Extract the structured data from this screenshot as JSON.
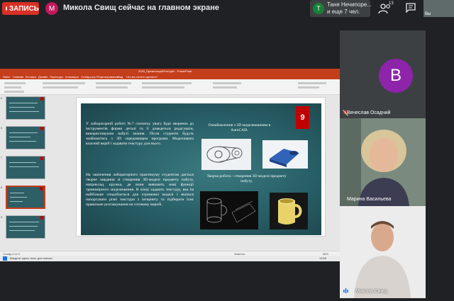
{
  "meet": {
    "record_label": "ЗАПИСЬ",
    "presenter_initial": "М",
    "presenter_text": "Микола Свищ сейчас на главном экране",
    "notification": {
      "initial": "Т",
      "line1": "Таня Нечипоре...",
      "line2": "и еще 7 чел."
    },
    "participants_count": "13",
    "self_label": "Вы",
    "colors": {
      "record": "#d93025",
      "background": "#202124",
      "tile": "#3c4043"
    }
  },
  "participants": [
    {
      "name": "Вячеслав Осадчий",
      "initial": "В",
      "muted": true,
      "avatar_color": "#8e24aa"
    },
    {
      "name": "Марина Васильева",
      "muted": false
    },
    {
      "name": "Микола Свищ",
      "muted": false,
      "speaking": true
    }
  ],
  "powerpoint": {
    "window_title": "2020_ПрезентаціяFinal.pptx - PowerPoint",
    "menu": [
      "Файл",
      "Главная",
      "Вставка",
      "Дизайн",
      "Переходы",
      "Анимация",
      "Слайд-шоу",
      "Рецензирование",
      "Вид",
      "Что вы хотите сделать?"
    ],
    "status": {
      "slide": "Слайд 9 из 9",
      "notes": "Заметки",
      "zoom": "58%"
    },
    "taskbar": {
      "search": "Введите здесь текст для поиска",
      "time": "13:55"
    },
    "accent_color": "#c43e1c"
  },
  "slide": {
    "number": "9",
    "left_paragraph_1": "У лабораторній роботі №7 спочатку увагу буде звернено до інструментів форми деталі та її доведеться редагувати, використовуючи набуті знання. Після студенти будуть знайомитись з 3D середовищем програми. Моделювати власний виріб і задавати текстуру для нього.",
    "left_paragraph_2": "На закінчення лабораторного практикуму студентам дається творче завдання зі створення 3D-моделі предмету побуту, наприклад, кружка, де вони вивчають нові функції тривимірного моделювання. В кінці задають текстуру, яка їм найбільше сподобається для отриманої моделі і вчаться імпортувати різні текстури з інтернету та підбирати їхнє правильне розташування на готовому виробі.",
    "right_heading_1": "Ознайомлення з 3D моделюванням в AutoCAD.",
    "right_heading_2": "Творча робота - створення 3D моделі предмету побуту."
  }
}
